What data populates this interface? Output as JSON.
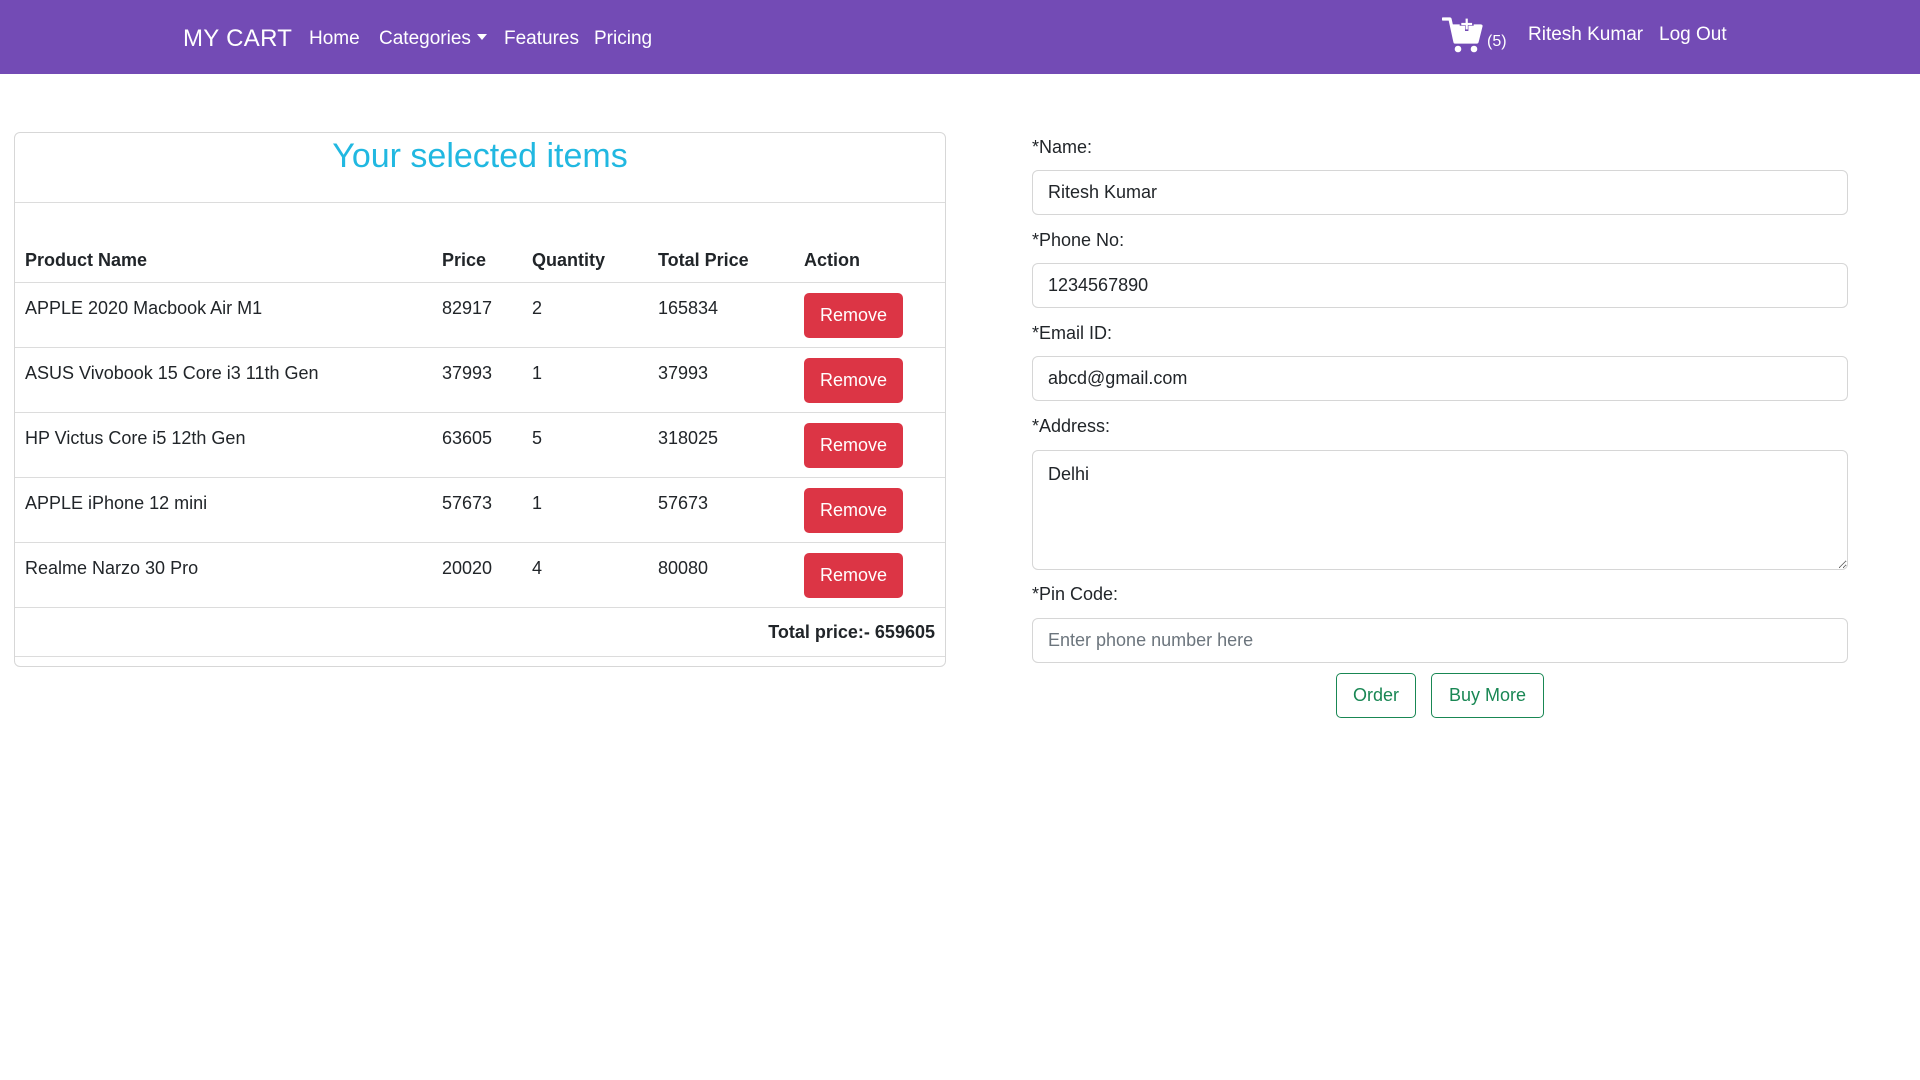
{
  "navbar": {
    "brand": "MY CART",
    "links": [
      "Home",
      "Categories",
      "Features",
      "Pricing"
    ],
    "cart_icon": "cart-plus-icon",
    "cart_count": "(5)",
    "user_name": "Ritesh Kumar",
    "logout": "Log Out",
    "background_color": "#734bb5"
  },
  "cart": {
    "title": "Your selected items",
    "title_color": "#21b8e1",
    "headers": [
      "Product Name",
      "Price",
      "Quantity",
      "Total Price",
      "Action"
    ],
    "rows": [
      {
        "name": "APPLE 2020 Macbook Air M1",
        "price": "82917",
        "quantity": "2",
        "total": "165834",
        "action": "Remove"
      },
      {
        "name": "ASUS Vivobook 15 Core i3 11th Gen",
        "price": "37993",
        "quantity": "1",
        "total": "37993",
        "action": "Remove"
      },
      {
        "name": "HP Victus Core i5 12th Gen",
        "price": "63605",
        "quantity": "5",
        "total": "318025",
        "action": "Remove"
      },
      {
        "name": "APPLE iPhone 12 mini",
        "price": "57673",
        "quantity": "1",
        "total": "57673",
        "action": "Remove"
      },
      {
        "name": "Realme Narzo 30 Pro",
        "price": "20020",
        "quantity": "4",
        "total": "80080",
        "action": "Remove"
      }
    ],
    "total_text": "Total price:- 659605",
    "remove_color": "#dc3545"
  },
  "form": {
    "name_label": "*Name:",
    "name_value": "Ritesh Kumar",
    "phone_label": "*Phone No:",
    "phone_value": "1234567890",
    "email_label": "*Email ID:",
    "email_value": "abcd@gmail.com",
    "address_label": "*Address:",
    "address_value": "Delhi",
    "pin_label": "*Pin Code:",
    "pin_placeholder": "Enter phone number here",
    "order_button": "Order",
    "buy_more_button": "Buy More",
    "button_color": "#198754"
  }
}
